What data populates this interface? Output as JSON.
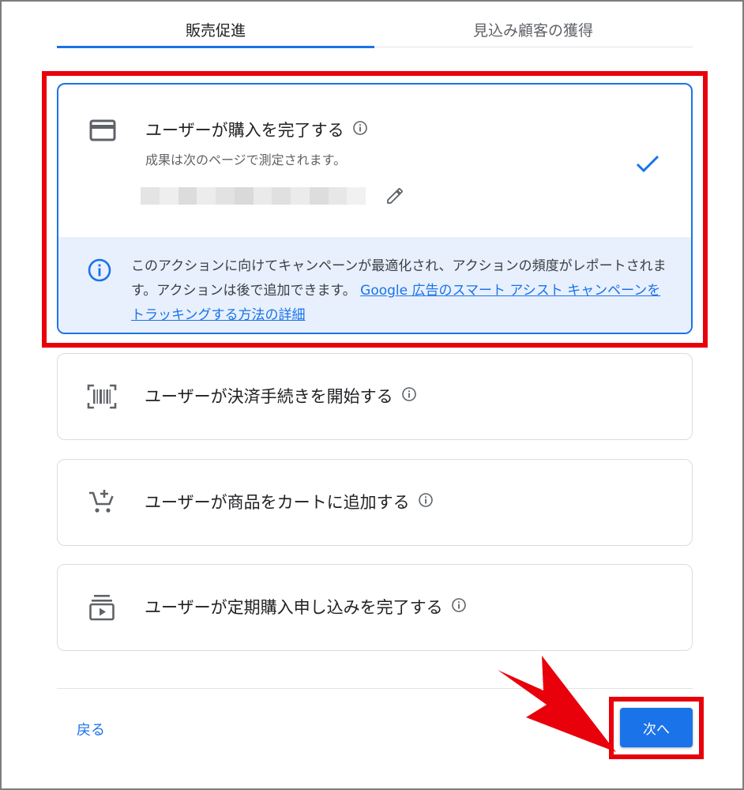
{
  "tabs": [
    {
      "label": "販売促進",
      "active": true
    },
    {
      "label": "見込み顧客の獲得",
      "active": false
    }
  ],
  "options": [
    {
      "icon": "credit-card-icon",
      "title": "ユーザーが購入を完了する",
      "subtitle": "成果は次のページで測定されます。",
      "selected": true,
      "info_text": "このアクションに向けてキャンペーンが最適化され、アクションの頻度がレポートされます。アクションは後で追加できます。",
      "info_link": "Google 広告のスマート アシスト キャンペーンをトラッキングする方法の詳細"
    },
    {
      "icon": "barcode-scan-icon",
      "title": "ユーザーが決済手続きを開始する",
      "selected": false
    },
    {
      "icon": "add-shopping-cart-icon",
      "title": "ユーザーが商品をカートに追加する",
      "selected": false
    },
    {
      "icon": "subscriptions-icon",
      "title": "ユーザーが定期購入申し込みを完了する",
      "selected": false
    }
  ],
  "footer": {
    "back_label": "戻る",
    "next_label": "次へ"
  },
  "colors": {
    "accent": "#1a73e8",
    "highlight": "#e8000b",
    "info_bg": "#e8f0fe"
  }
}
